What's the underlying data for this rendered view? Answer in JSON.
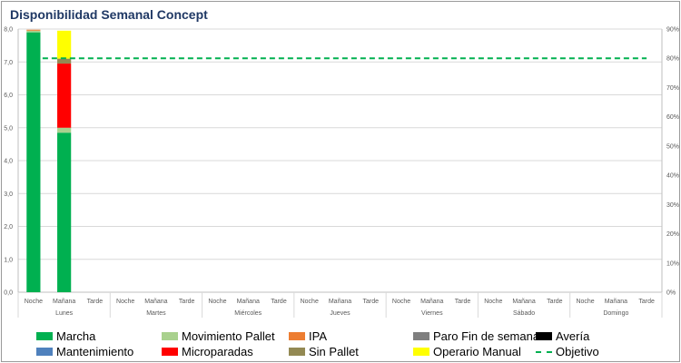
{
  "chart_data": {
    "type": "bar",
    "stacked": true,
    "title": "Disponibilidad Semanal Concept",
    "days": [
      "Lunes",
      "Martes",
      "Miércoles",
      "Jueves",
      "Viernes",
      "Sábado",
      "Domingo"
    ],
    "shifts": [
      "Noche",
      "Mañana",
      "Tarde"
    ],
    "ylim": [
      0,
      8
    ],
    "y_ticks": [
      "0,0",
      "1,0",
      "2,0",
      "3,0",
      "4,0",
      "5,0",
      "6,0",
      "7,0",
      "8,0"
    ],
    "y2lim": [
      0,
      90
    ],
    "y2_ticks": [
      "0%",
      "10%",
      "20%",
      "30%",
      "40%",
      "50%",
      "60%",
      "70%",
      "80%",
      "90%"
    ],
    "grid": true,
    "legend_position": "bottom",
    "series": [
      {
        "name": "Marcha",
        "color": "#00b050",
        "values": [
          7.9,
          4.85,
          0,
          0,
          0,
          0,
          0,
          0,
          0,
          0,
          0,
          0,
          0,
          0,
          0,
          0,
          0,
          0,
          0,
          0,
          0
        ]
      },
      {
        "name": "Movimiento Pallet",
        "color": "#a9d18e",
        "values": [
          0.05,
          0.15,
          0,
          0,
          0,
          0,
          0,
          0,
          0,
          0,
          0,
          0,
          0,
          0,
          0,
          0,
          0,
          0,
          0,
          0,
          0
        ]
      },
      {
        "name": "IPA",
        "color": "#ed7d31",
        "values": [
          0.03,
          0,
          0,
          0,
          0,
          0,
          0,
          0,
          0,
          0,
          0,
          0,
          0,
          0,
          0,
          0,
          0,
          0,
          0,
          0,
          0
        ]
      },
      {
        "name": "Paro Fin de semana",
        "color": "#7f7f7f",
        "values": [
          0,
          0,
          0,
          0,
          0,
          0,
          0,
          0,
          0,
          0,
          0,
          0,
          0,
          0,
          0,
          0,
          0,
          0,
          0,
          0,
          0
        ]
      },
      {
        "name": "Avería",
        "color": "#000000",
        "values": [
          0,
          0,
          0,
          0,
          0,
          0,
          0,
          0,
          0,
          0,
          0,
          0,
          0,
          0,
          0,
          0,
          0,
          0,
          0,
          0,
          0
        ]
      },
      {
        "name": "Mantenimiento",
        "color": "#4f81bd",
        "values": [
          0,
          0,
          0,
          0,
          0,
          0,
          0,
          0,
          0,
          0,
          0,
          0,
          0,
          0,
          0,
          0,
          0,
          0,
          0,
          0,
          0
        ]
      },
      {
        "name": "Microparadas",
        "color": "#ff0000",
        "values": [
          0,
          1.95,
          0,
          0,
          0,
          0,
          0,
          0,
          0,
          0,
          0,
          0,
          0,
          0,
          0,
          0,
          0,
          0,
          0,
          0,
          0
        ]
      },
      {
        "name": "Sin Pallet",
        "color": "#938953",
        "values": [
          0,
          0.15,
          0,
          0,
          0,
          0,
          0,
          0,
          0,
          0,
          0,
          0,
          0,
          0,
          0,
          0,
          0,
          0,
          0,
          0,
          0
        ]
      },
      {
        "name": "Operario Manual",
        "color": "#ffff00",
        "values": [
          0,
          0.85,
          0,
          0,
          0,
          0,
          0,
          0,
          0,
          0,
          0,
          0,
          0,
          0,
          0,
          0,
          0,
          0,
          0,
          0,
          0
        ]
      }
    ],
    "target": {
      "name": "Objetivo",
      "color": "#00b050",
      "value_pct": 80
    }
  }
}
